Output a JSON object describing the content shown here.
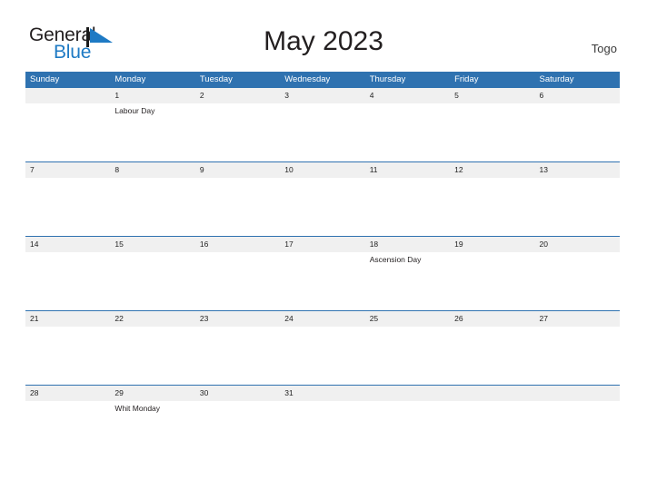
{
  "brand": {
    "name_part1": "General",
    "name_part2": "Blue",
    "mark_icon": "blue-triangle-flag-icon",
    "accent_color": "#1e7ac4"
  },
  "header": {
    "title": "May 2023",
    "locale": "Togo"
  },
  "theme": {
    "header_blue": "#2f72b0",
    "date_band_gray": "#f0f0f0",
    "rule_blue": "#2f72b0",
    "text_dark": "#231f20"
  },
  "calendar": {
    "month": "May",
    "year": "2023",
    "weekdays": [
      "Sunday",
      "Monday",
      "Tuesday",
      "Wednesday",
      "Thursday",
      "Friday",
      "Saturday"
    ],
    "weeks": [
      {
        "rule": false,
        "days": [
          {
            "date": "",
            "events": []
          },
          {
            "date": "1",
            "events": [
              "Labour Day"
            ]
          },
          {
            "date": "2",
            "events": []
          },
          {
            "date": "3",
            "events": []
          },
          {
            "date": "4",
            "events": []
          },
          {
            "date": "5",
            "events": []
          },
          {
            "date": "6",
            "events": []
          }
        ]
      },
      {
        "rule": true,
        "days": [
          {
            "date": "7",
            "events": []
          },
          {
            "date": "8",
            "events": []
          },
          {
            "date": "9",
            "events": []
          },
          {
            "date": "10",
            "events": []
          },
          {
            "date": "11",
            "events": []
          },
          {
            "date": "12",
            "events": []
          },
          {
            "date": "13",
            "events": []
          }
        ]
      },
      {
        "rule": true,
        "days": [
          {
            "date": "14",
            "events": []
          },
          {
            "date": "15",
            "events": []
          },
          {
            "date": "16",
            "events": []
          },
          {
            "date": "17",
            "events": []
          },
          {
            "date": "18",
            "events": [
              "Ascension Day"
            ]
          },
          {
            "date": "19",
            "events": []
          },
          {
            "date": "20",
            "events": []
          }
        ]
      },
      {
        "rule": true,
        "days": [
          {
            "date": "21",
            "events": []
          },
          {
            "date": "22",
            "events": []
          },
          {
            "date": "23",
            "events": []
          },
          {
            "date": "24",
            "events": []
          },
          {
            "date": "25",
            "events": []
          },
          {
            "date": "26",
            "events": []
          },
          {
            "date": "27",
            "events": []
          }
        ]
      },
      {
        "rule": true,
        "days": [
          {
            "date": "28",
            "events": []
          },
          {
            "date": "29",
            "events": [
              "Whit Monday"
            ]
          },
          {
            "date": "30",
            "events": []
          },
          {
            "date": "31",
            "events": []
          },
          {
            "date": "",
            "events": []
          },
          {
            "date": "",
            "events": []
          },
          {
            "date": "",
            "events": []
          }
        ]
      }
    ]
  }
}
